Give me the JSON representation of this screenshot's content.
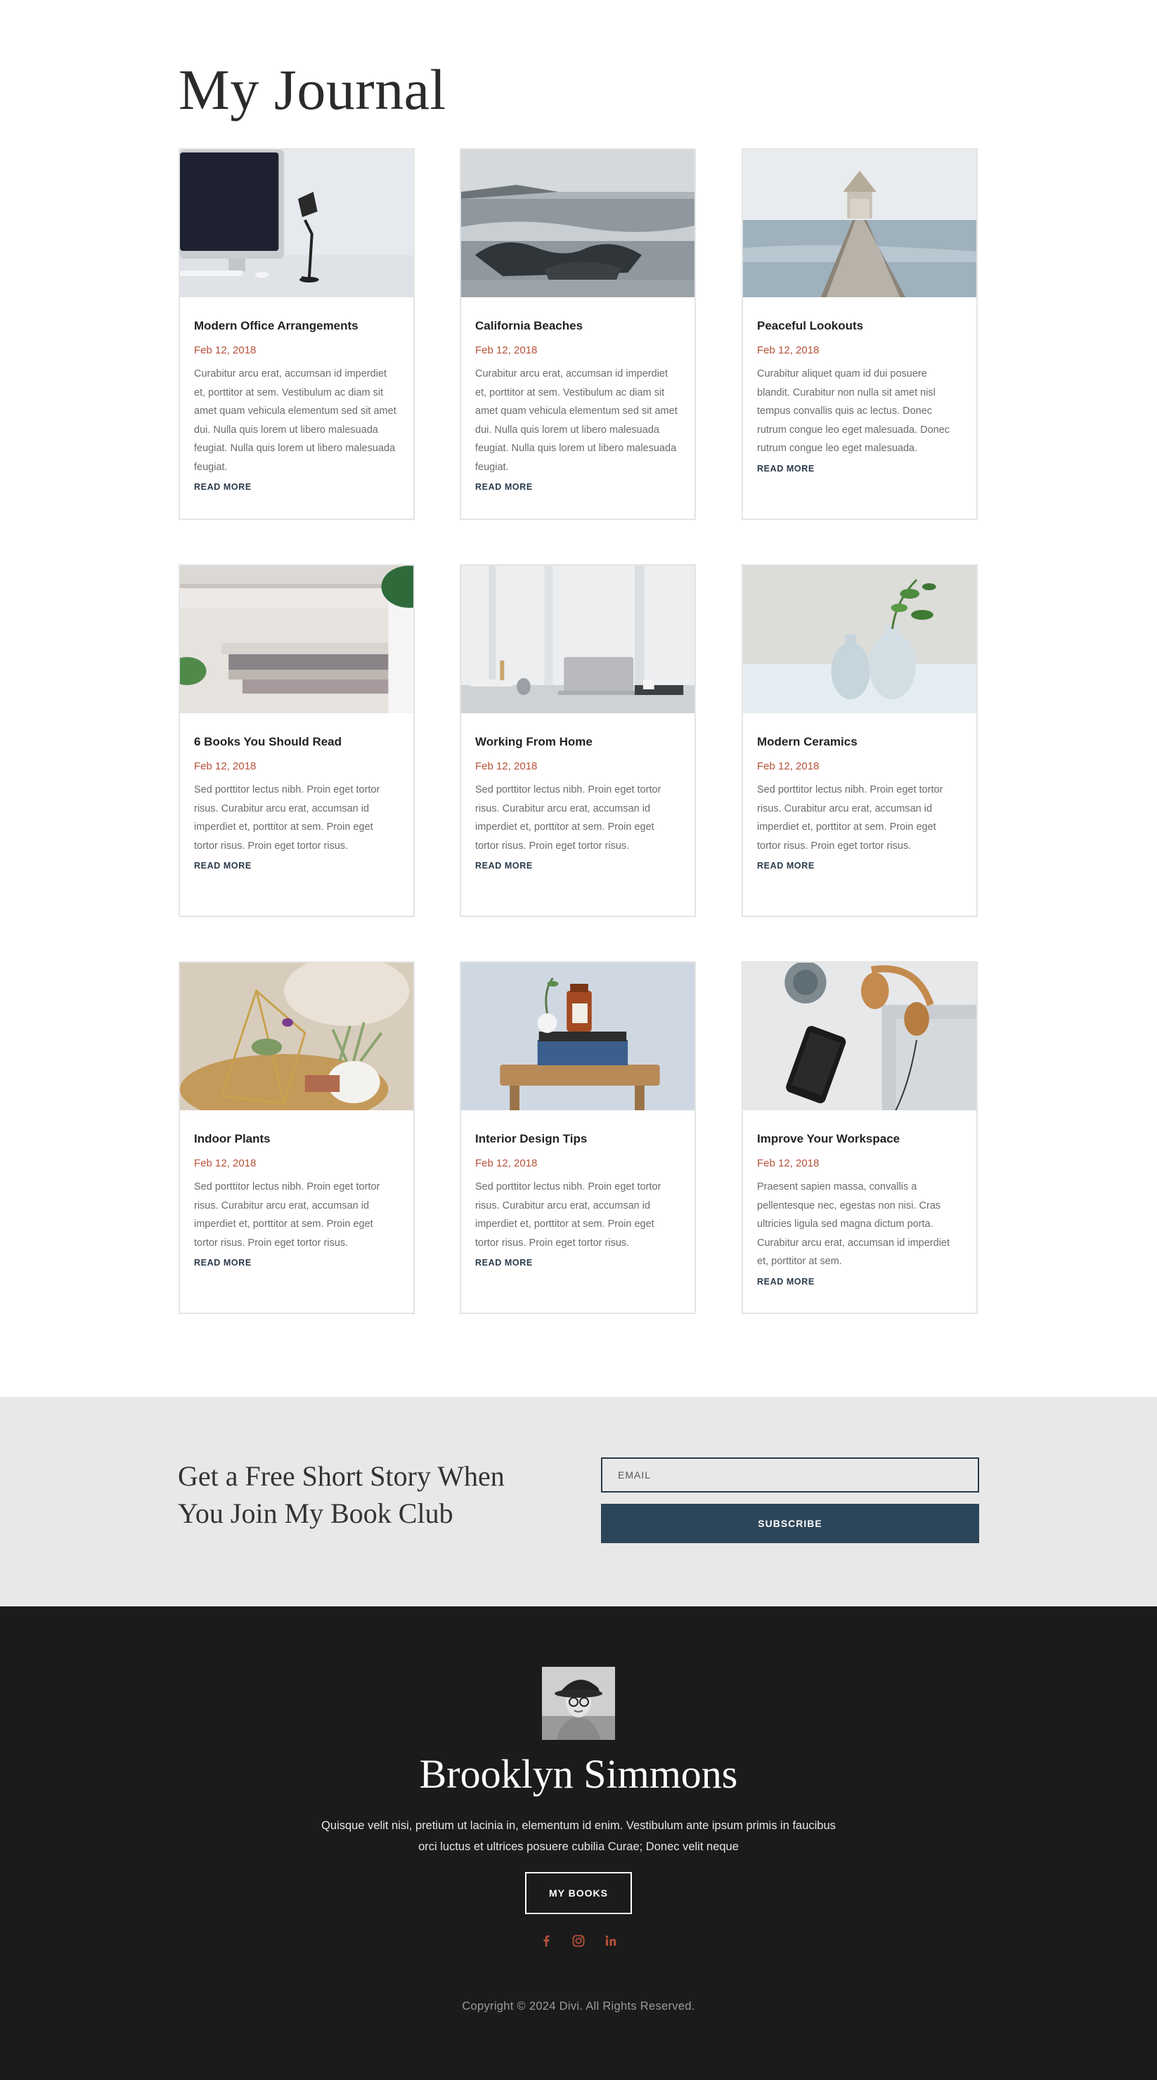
{
  "journal": {
    "title": "My Journal",
    "read_more_label": "READ MORE",
    "posts": [
      {
        "title": "Modern Office Arrangements",
        "date": "Feb 12, 2018",
        "excerpt": "Curabitur arcu erat, accumsan id imperdiet et, porttitor at sem. Vestibulum ac diam sit amet quam vehicula elementum sed sit amet dui. Nulla quis lorem ut libero malesuada feugiat. Nulla quis lorem ut libero malesuada feugiat.",
        "read_more": "READ MORE"
      },
      {
        "title": "California Beaches",
        "date": "Feb 12, 2018",
        "excerpt": "Curabitur arcu erat, accumsan id imperdiet et, porttitor at sem. Vestibulum ac diam sit amet quam vehicula elementum sed sit amet dui. Nulla quis lorem ut libero malesuada feugiat. Nulla quis lorem ut libero malesuada feugiat.",
        "read_more": "READ MORE"
      },
      {
        "title": "Peaceful Lookouts",
        "date": "Feb 12, 2018",
        "excerpt": "Curabitur aliquet quam id dui posuere blandit. Curabitur non nulla sit amet nisl tempus convallis quis ac lectus. Donec rutrum congue leo eget malesuada. Donec rutrum congue leo eget malesuada.",
        "read_more": "READ MORE"
      },
      {
        "title": "6 Books You Should Read",
        "date": "Feb 12, 2018",
        "excerpt": "Sed porttitor lectus nibh. Proin eget tortor risus. Curabitur arcu erat, accumsan id imperdiet et, porttitor at sem. Proin eget tortor risus. Proin eget tortor risus.",
        "read_more": "READ MORE"
      },
      {
        "title": "Working From Home",
        "date": "Feb 12, 2018",
        "excerpt": "Sed porttitor lectus nibh. Proin eget tortor risus. Curabitur arcu erat, accumsan id imperdiet et, porttitor at sem. Proin eget tortor risus. Proin eget tortor risus.",
        "read_more": "READ MORE"
      },
      {
        "title": "Modern Ceramics",
        "date": "Feb 12, 2018",
        "excerpt": "Sed porttitor lectus nibh. Proin eget tortor risus. Curabitur arcu erat, accumsan id imperdiet et, porttitor at sem. Proin eget tortor risus. Proin eget tortor risus.",
        "read_more": "READ MORE"
      },
      {
        "title": "Indoor Plants",
        "date": "Feb 12, 2018",
        "excerpt": "Sed porttitor lectus nibh. Proin eget tortor risus. Curabitur arcu erat, accumsan id imperdiet et, porttitor at sem. Proin eget tortor risus. Proin eget tortor risus.",
        "read_more": "READ MORE"
      },
      {
        "title": "Interior Design Tips",
        "date": "Feb 12, 2018",
        "excerpt": "Sed porttitor lectus nibh. Proin eget tortor risus. Curabitur arcu erat, accumsan id imperdiet et, porttitor at sem. Proin eget tortor risus. Proin eget tortor risus.",
        "read_more": "READ MORE"
      },
      {
        "title": "Improve Your Workspace",
        "date": "Feb 12, 2018",
        "excerpt": "Praesent sapien massa, convallis a pellentesque nec, egestas non nisi. Cras ultricies ligula sed magna dictum porta. Curabitur arcu erat, accumsan id imperdiet et, porttitor at sem.",
        "read_more": "READ MORE"
      }
    ]
  },
  "signup": {
    "heading": "Get a Free Short Story When You Join My Book Club",
    "email_placeholder": "EMAIL",
    "subscribe_label": "SUBSCRIBE"
  },
  "footer": {
    "author_name": "Brooklyn Simmons",
    "bio": "Quisque velit nisi, pretium ut lacinia in, elementum id enim. Vestibulum ante ipsum primis in faucibus orci luctus et ultrices posuere cubilia Curae; Donec velit neque",
    "books_button": "MY BOOKS",
    "social_icons": [
      "facebook-icon",
      "instagram-icon",
      "linkedin-icon"
    ],
    "copyright": "Copyright © 2024 Divi. All Rights Reserved."
  },
  "colors": {
    "accent": "#b5513a",
    "button_dark": "#2d4559",
    "footer_bg": "#1b1b1b",
    "signup_bg": "#e8e8e8"
  }
}
